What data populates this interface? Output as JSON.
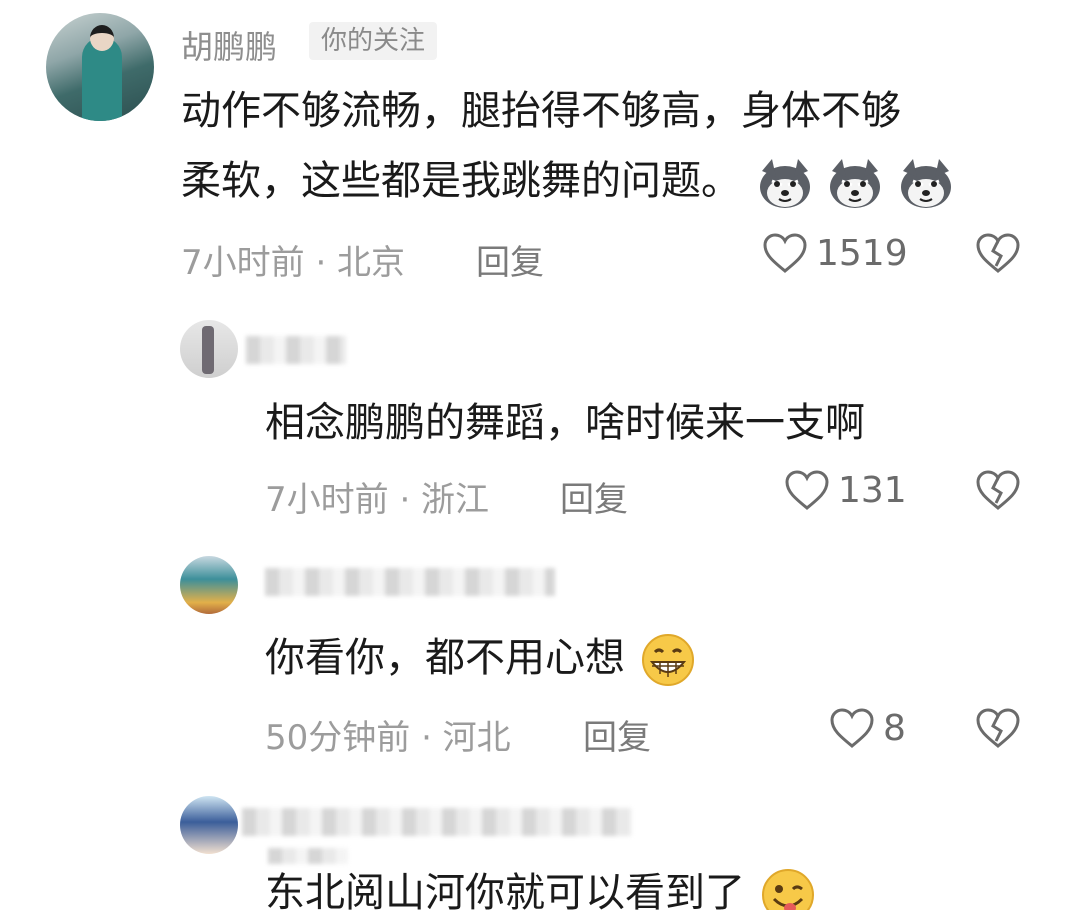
{
  "comments": [
    {
      "username": "胡鹏鹏",
      "badge": "你的关注",
      "line1": "动作不够流畅，腿抬得不够高，身体不够",
      "line2": "柔软，这些都是我跳舞的问题。",
      "meta": "7小时前 · 北京",
      "reply": "回复",
      "likes": "1519",
      "emoji_icon": "husky-dog-emoji"
    },
    {
      "text": "相念鹏鹏的舞蹈，啥时候来一支啊",
      "meta": "7小时前 · 浙江",
      "reply": "回复",
      "likes": "131"
    },
    {
      "text": "你看你，都不用心想",
      "meta": "50分钟前 · 河北",
      "reply": "回复",
      "likes": "8",
      "emoji_icon": "grinning-face-emoji"
    },
    {
      "text": "东北阅山河你就可以看到了",
      "emoji_icon": "winking-tongue-face-emoji"
    }
  ],
  "icons": {
    "like": "heart-outline-icon",
    "dislike": "broken-heart-icon"
  },
  "colors": {
    "meta_gray": "#9c9c9c",
    "text_black": "#1a1a1a",
    "badge_bg": "#f2f2f2"
  }
}
